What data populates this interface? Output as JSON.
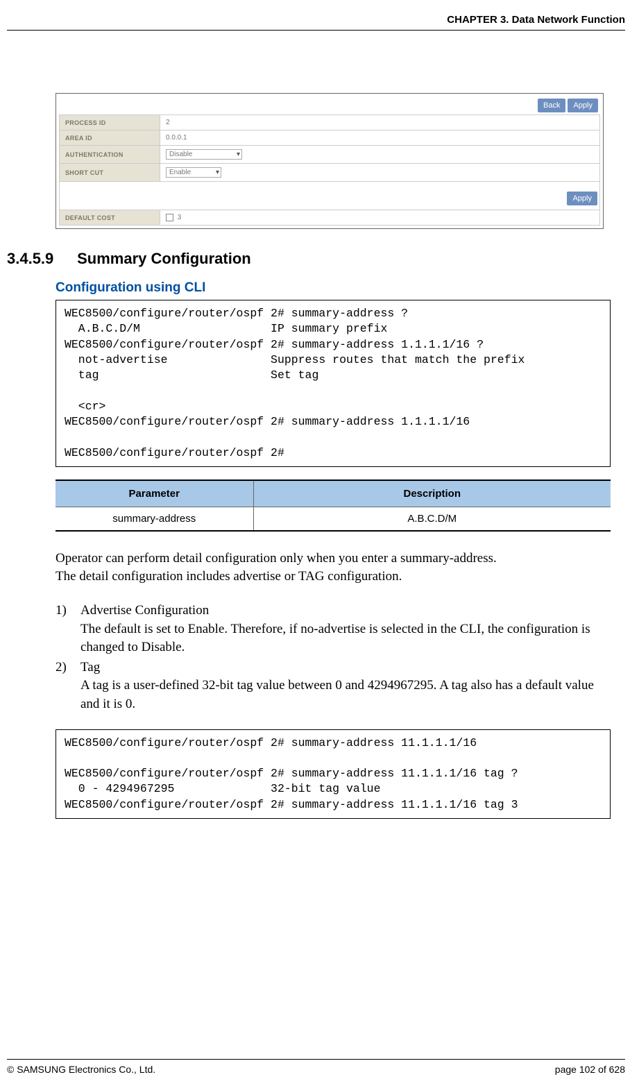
{
  "header": {
    "chapter": "CHAPTER 3. Data Network Function"
  },
  "screenshot": {
    "buttons": {
      "back": "Back",
      "apply": "Apply"
    },
    "rows": [
      {
        "label": "PROCESS ID",
        "value": "2",
        "type": "text"
      },
      {
        "label": "AREA ID",
        "value": "0.0.0.1",
        "type": "text"
      },
      {
        "label": "AUTHENTICATION",
        "value": "Disable",
        "type": "select"
      },
      {
        "label": "SHORT CUT",
        "value": "Enable",
        "type": "select"
      }
    ],
    "default_cost": {
      "label": "DEFAULT COST",
      "value": "3"
    }
  },
  "section": {
    "number": "3.4.5.9",
    "title": "Summary Configuration",
    "subtitle": "Configuration using CLI"
  },
  "code1": "WEC8500/configure/router/ospf 2# summary-address ?\n  A.B.C.D/M                   IP summary prefix\nWEC8500/configure/router/ospf 2# summary-address 1.1.1.1/16 ?\n  not-advertise               Suppress routes that match the prefix\n  tag                         Set tag\n\n  <cr>\nWEC8500/configure/router/ospf 2# summary-address 1.1.1.1/16\n\nWEC8500/configure/router/ospf 2#",
  "param_table": {
    "head": {
      "param": "Parameter",
      "desc": "Description"
    },
    "row": {
      "param": "summary-address",
      "desc": "A.B.C.D/M"
    }
  },
  "para1": "Operator can perform detail configuration only when you enter a summary-address.",
  "para2": "The detail configuration includes advertise or TAG configuration.",
  "list": {
    "item1": {
      "num": "1)",
      "title": "Advertise Configuration",
      "body": "The default is set to Enable. Therefore, if no-advertise is selected in the CLI, the configuration is changed to Disable."
    },
    "item2": {
      "num": "2)",
      "title": "Tag",
      "body": "A tag is a user-defined 32-bit tag value between 0 and 4294967295. A tag also has a default value and it is 0."
    }
  },
  "code2": "WEC8500/configure/router/ospf 2# summary-address 11.1.1.1/16\n\nWEC8500/configure/router/ospf 2# summary-address 11.1.1.1/16 tag ?\n  0 - 4294967295              32-bit tag value\nWEC8500/configure/router/ospf 2# summary-address 11.1.1.1/16 tag 3",
  "footer": {
    "copyright": "© SAMSUNG Electronics Co., Ltd.",
    "page": "page 102 of 628"
  }
}
